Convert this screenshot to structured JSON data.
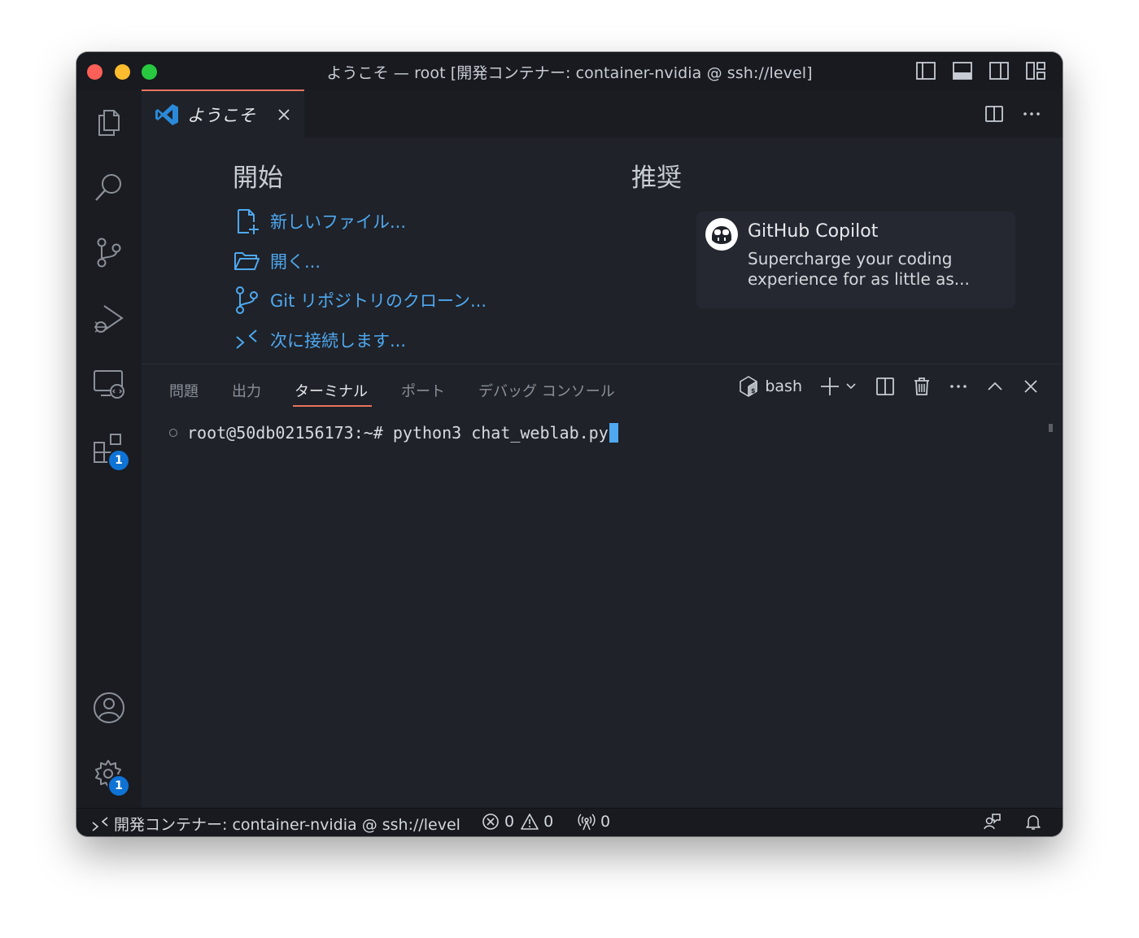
{
  "window": {
    "title": "ようこそ — root [開発コンテナー: container-nvidia @ ssh://level]"
  },
  "activity_bar": {
    "extensions_badge": "1",
    "settings_badge": "1"
  },
  "editor": {
    "tab_label": "ようこそ",
    "start": {
      "heading": "開始",
      "links": [
        {
          "label": "新しいファイル..."
        },
        {
          "label": "開く..."
        },
        {
          "label": "Git リポジトリのクローン..."
        },
        {
          "label": "次に接続します..."
        }
      ]
    },
    "recommended": {
      "heading": "推奨",
      "card_title": "GitHub Copilot",
      "card_desc": "Supercharge your coding experience for as little as..."
    }
  },
  "panel": {
    "tabs": [
      {
        "label": "問題"
      },
      {
        "label": "出力"
      },
      {
        "label": "ターミナル"
      },
      {
        "label": "ポート"
      },
      {
        "label": "デバッグ コンソール"
      }
    ],
    "shell_name": "bash",
    "terminal_prompt": "root@50db02156173:~# python3 chat_weblab.py"
  },
  "status_bar": {
    "remote": "開発コンテナー: container-nvidia @ ssh://level",
    "errors": "0",
    "warnings": "0",
    "ports": "0"
  },
  "colors": {
    "accent": "#4fa8f0",
    "tab_indicator": "#e8745f",
    "badge": "#0f73d6"
  }
}
